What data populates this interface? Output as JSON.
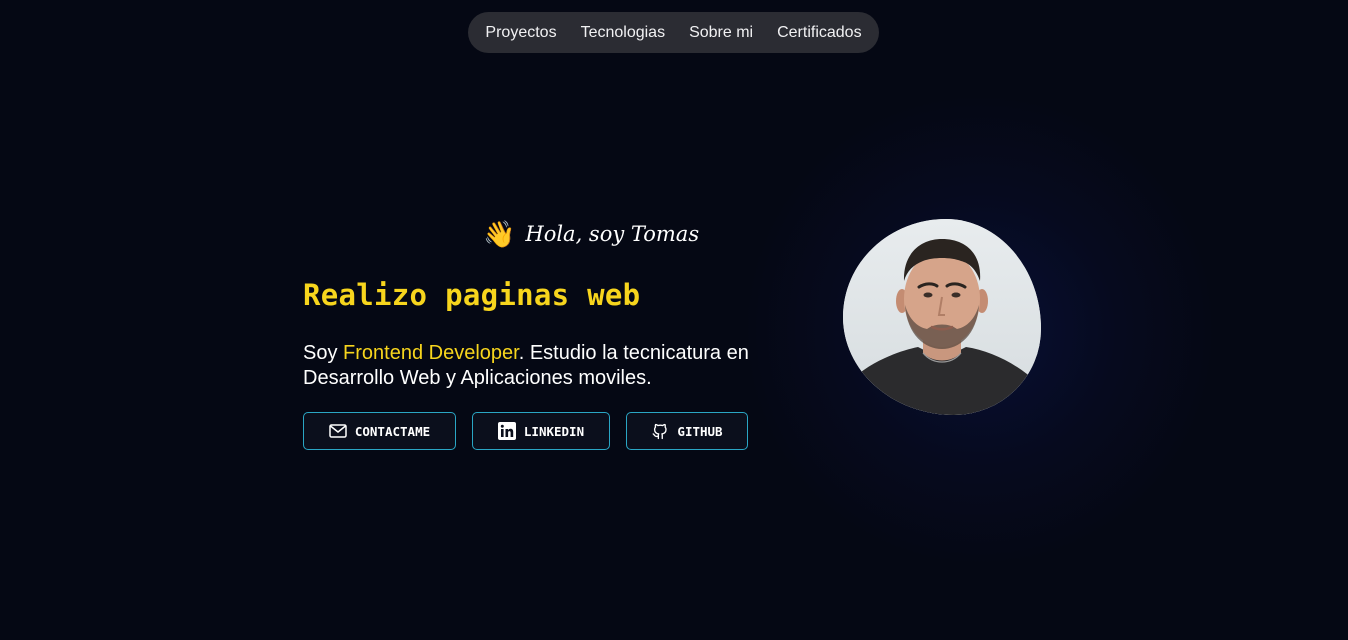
{
  "nav": {
    "items": [
      {
        "label": "Proyectos"
      },
      {
        "label": "Tecnologias"
      },
      {
        "label": "Sobre mi"
      },
      {
        "label": "Certificados"
      }
    ]
  },
  "hero": {
    "greeting_icon": "waving-hand-icon",
    "greeting": "Hola, soy Tomas",
    "headline": "Realizo paginas web",
    "description_prefix": "Soy ",
    "description_accent": "Frontend Developer",
    "description_suffix": ". Estudio la tecnicatura en Desarrollo Web y Aplicaciones moviles.",
    "buttons": [
      {
        "label": "CONTACTAME",
        "icon": "mail-icon"
      },
      {
        "label": "LINKEDIN",
        "icon": "linkedin-icon"
      },
      {
        "label": "GITHUB",
        "icon": "github-icon"
      }
    ],
    "avatar_icon": "profile-photo"
  },
  "colors": {
    "background": "#050814",
    "accent": "#f7d51d",
    "button_border": "#2aa6c4",
    "nav_background": "#2b2c33"
  }
}
